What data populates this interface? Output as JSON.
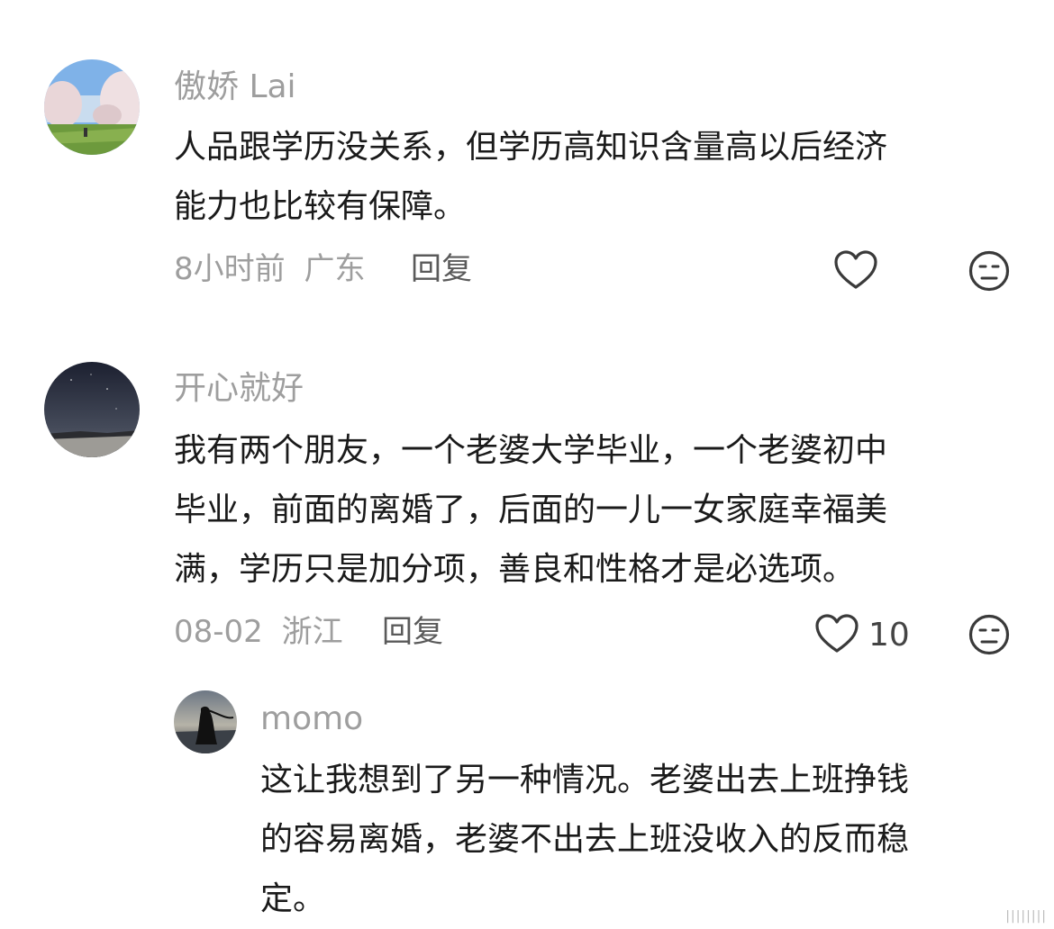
{
  "comments": [
    {
      "username": "傲娇 Lai",
      "text_lines": [
        "人品跟学历没关系，但学历高知识含量高以后经济",
        "能力也比较有保障。"
      ],
      "time": "8小时前",
      "location": "广东",
      "reply_label": "回复",
      "like_count": "",
      "avatar_icon": "cherry-blossom-avatar"
    },
    {
      "username": "开心就好",
      "text_lines": [
        "我有两个朋友，一个老婆大学毕业，一个老婆初中",
        "毕业，前面的离婚了，后面的一儿一女家庭幸福美",
        "满，学历只是加分项，善良和性格才是必选项。"
      ],
      "time": "08-02",
      "location": "浙江",
      "reply_label": "回复",
      "like_count": "10",
      "avatar_icon": "night-sky-avatar"
    }
  ],
  "replies": [
    {
      "username": "momo",
      "text_lines": [
        "这让我想到了另一种情况。老婆出去上班挣钱",
        "的容易离婚，老婆不出去上班没收入的反而稳",
        "定。"
      ],
      "avatar_icon": "silhouette-avatar"
    }
  ],
  "icons": {
    "like": "heart-outline-icon",
    "dislike": "meh-face-icon"
  },
  "watermark": "||||||||"
}
